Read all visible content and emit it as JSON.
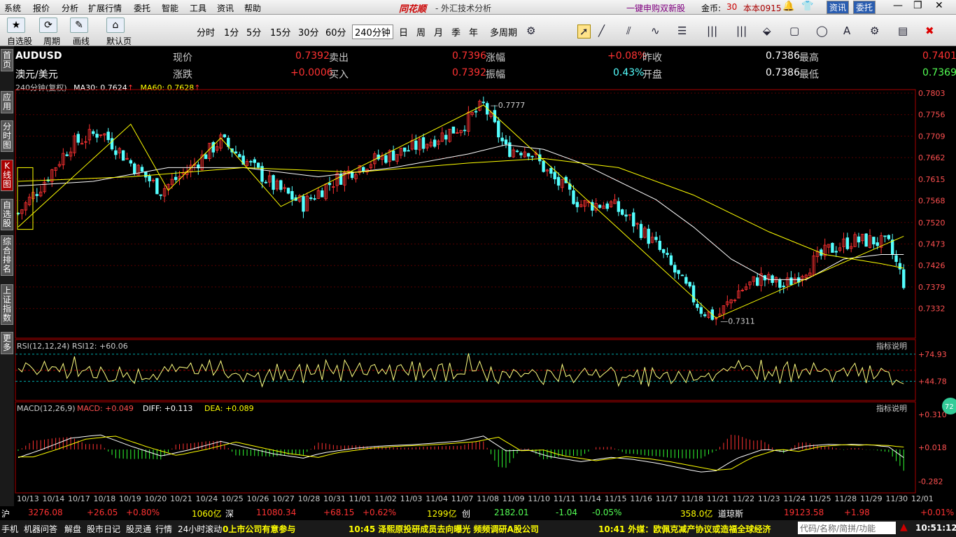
{
  "menu": [
    "系统",
    "报价",
    "分析",
    "扩展行情",
    "委托",
    "智能",
    "工具",
    "资讯",
    "帮助"
  ],
  "brand": "同花顺",
  "brand_sub": "- 外汇技术分析",
  "promo": "一键申购双新股",
  "coin_label": "金币:",
  "coin_value": "30",
  "account": "本本0915",
  "btn_info": "资讯",
  "btn_trade": "委托",
  "toolbar": {
    "self_select": "自选股",
    "period": "周期",
    "draw": "画线",
    "default_page": "默认页",
    "periods": [
      "分时",
      "1分",
      "5分",
      "15分",
      "30分",
      "60分",
      "240分钟",
      "日",
      "周",
      "月",
      "季",
      "年",
      "多周期"
    ],
    "selected_period": "240分钟"
  },
  "quote": {
    "code": "AUDUSD",
    "name": "澳元/美元",
    "l_now": "现价",
    "v_now": "0.7392",
    "l_sell": "卖出",
    "v_sell": "0.7396",
    "l_pct": "涨幅",
    "v_pct": "+0.08%",
    "l_prev": "昨收",
    "v_prev": "0.7386",
    "l_high": "最高",
    "v_high": "0.7401",
    "l_chg": "涨跌",
    "v_chg": "+0.0006",
    "l_buy": "买入",
    "v_buy": "0.7392",
    "l_amp": "振幅",
    "v_amp": "0.43%",
    "l_open": "开盘",
    "v_open": "0.7386",
    "l_low": "最低",
    "v_low": "0.7369"
  },
  "sidebar": [
    "首页",
    "应用",
    "分时图",
    "K线图",
    "自选股",
    "综合排名",
    "上证指数",
    "更多"
  ],
  "sidebar_selected": "K线图",
  "indicator_label": "240分钟(复权)",
  "ma30_label": "MA30: 0.7624",
  "ma60_label": "MA60: 0.7628",
  "rsi_label": "RSI(12,12,24)  RSI12: +60.06",
  "macd_label": "MACD(12,26,9)",
  "macd_value": "MACD: +0.049",
  "diff_value": "DIFF: +0.113",
  "dea_value": "DEA: +0.089",
  "indicator_help": "指标说明",
  "peak_label": "0.7777",
  "trough_label": "0.7311",
  "badge": "72",
  "chart_data": {
    "type": "candlestick",
    "title": "",
    "y_ticks": [
      "0.7803",
      "0.7756",
      "0.7709",
      "0.7662",
      "0.7615",
      "0.7568",
      "0.7520",
      "0.7473",
      "0.7426",
      "0.7379",
      "0.7332"
    ],
    "ylim": [
      0.729,
      0.7803
    ],
    "x_labels": [
      "10/13",
      "10/14",
      "10/17",
      "10/18",
      "10/19",
      "10/20",
      "10/21",
      "10/24",
      "10/25",
      "10/26",
      "10/27",
      "10/28",
      "10/31",
      "11/01",
      "11/02",
      "11/03",
      "11/04",
      "11/07",
      "11/08",
      "11/09",
      "11/10",
      "11/11",
      "11/14",
      "11/15",
      "11/16",
      "11/17",
      "11/18",
      "11/21",
      "11/22",
      "11/23",
      "11/24",
      "11/25",
      "11/28",
      "11/29",
      "11/30",
      "12/01"
    ],
    "close_path": [
      [
        0,
        0.754
      ],
      [
        6,
        0.76
      ],
      [
        14,
        0.769
      ],
      [
        22,
        0.772
      ],
      [
        30,
        0.765
      ],
      [
        38,
        0.759
      ],
      [
        46,
        0.764
      ],
      [
        54,
        0.77
      ],
      [
        60,
        0.766
      ],
      [
        68,
        0.76
      ],
      [
        76,
        0.756
      ],
      [
        82,
        0.76
      ],
      [
        90,
        0.764
      ],
      [
        96,
        0.766
      ],
      [
        104,
        0.768
      ],
      [
        110,
        0.77
      ],
      [
        118,
        0.773
      ],
      [
        124,
        0.7777
      ],
      [
        130,
        0.768
      ],
      [
        136,
        0.768
      ],
      [
        142,
        0.762
      ],
      [
        150,
        0.756
      ],
      [
        158,
        0.756
      ],
      [
        164,
        0.752
      ],
      [
        170,
        0.747
      ],
      [
        176,
        0.74
      ],
      [
        182,
        0.733
      ],
      [
        186,
        0.7311
      ],
      [
        192,
        0.737
      ],
      [
        198,
        0.74
      ],
      [
        204,
        0.738
      ],
      [
        210,
        0.742
      ],
      [
        216,
        0.746
      ],
      [
        222,
        0.748
      ],
      [
        228,
        0.748
      ],
      [
        232,
        0.747
      ],
      [
        236,
        0.739
      ]
    ],
    "ma30": [
      [
        0,
        0.76
      ],
      [
        20,
        0.761
      ],
      [
        40,
        0.764
      ],
      [
        60,
        0.764
      ],
      [
        80,
        0.762
      ],
      [
        100,
        0.764
      ],
      [
        120,
        0.767
      ],
      [
        130,
        0.769
      ],
      [
        140,
        0.768
      ],
      [
        150,
        0.765
      ],
      [
        160,
        0.761
      ],
      [
        170,
        0.757
      ],
      [
        180,
        0.751
      ],
      [
        190,
        0.744
      ],
      [
        200,
        0.7395
      ],
      [
        210,
        0.7395
      ],
      [
        220,
        0.744
      ],
      [
        230,
        0.745
      ],
      [
        236,
        0.745
      ]
    ],
    "ma60": [
      [
        0,
        0.761
      ],
      [
        30,
        0.762
      ],
      [
        60,
        0.764
      ],
      [
        90,
        0.763
      ],
      [
        120,
        0.765
      ],
      [
        140,
        0.766
      ],
      [
        160,
        0.764
      ],
      [
        180,
        0.758
      ],
      [
        200,
        0.75
      ],
      [
        215,
        0.745
      ],
      [
        230,
        0.743
      ],
      [
        236,
        0.742
      ]
    ],
    "rsi_ticks": [
      "+74.93",
      "+44.78"
    ],
    "macd_ticks": [
      "+0.310",
      "+0.018",
      "-0.282"
    ]
  },
  "status": {
    "sh_label": "沪",
    "sh_val": "3276.08",
    "sh_chg": "+26.05",
    "sh_pct": "+0.80%",
    "sh_amt": "1060亿",
    "sz_label": "深",
    "sz_val": "11080.34",
    "sz_chg": "+68.15",
    "sz_pct": "+0.62%",
    "sz_amt": "1299亿",
    "cy_label": "创",
    "cy_val": "2182.01",
    "cy_chg": "-1.04",
    "cy_pct": "-0.05%",
    "cy_amt": "358.0亿",
    "dj_label": "道琼斯",
    "dj_val": "19123.58",
    "dj_chg": "+1.98",
    "dj_pct": "+0.01%"
  },
  "news": {
    "tabs": [
      "手机",
      "机器问答",
      "解盘",
      "股市日记",
      "股灵通",
      "行情",
      "24小时滚动"
    ],
    "n1": "0上市公司有意参与",
    "n2": "10:45 泽熙原投研成员去向曝光 频频调研A股公司",
    "n3": "10:41 外媒：欧佩克减产协议或造福全球经济",
    "search": "代码/名称/简拼/功能",
    "clock": "10:51:12"
  },
  "colors": {
    "up": "#ff3232",
    "down": "#54ffff",
    "ma30": "#ffffff",
    "ma60": "#ffff00"
  }
}
